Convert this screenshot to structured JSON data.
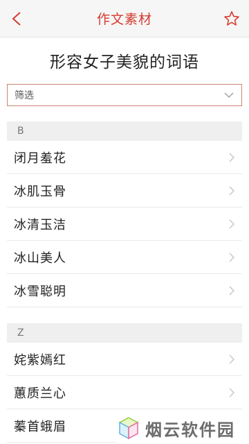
{
  "header": {
    "title": "作文素材",
    "back_icon": "chevron-left-icon",
    "favorite_icon": "star-outline-icon",
    "accent_color": "#d63b30"
  },
  "page": {
    "heading": "形容女子美貌的词语"
  },
  "filter": {
    "label": "筛选",
    "icon": "chevron-down-icon",
    "border_color": "#c8846f"
  },
  "sections": [
    {
      "letter": "B",
      "items": [
        "闭月羞花",
        "冰肌玉骨",
        "冰清玉洁",
        "冰山美人",
        "冰雪聪明"
      ]
    },
    {
      "letter": "Z",
      "items": [
        "姹紫嫣红",
        "蕙质兰心",
        "蓁首蛾眉"
      ]
    }
  ],
  "watermark": {
    "text": "烟云软件园"
  }
}
